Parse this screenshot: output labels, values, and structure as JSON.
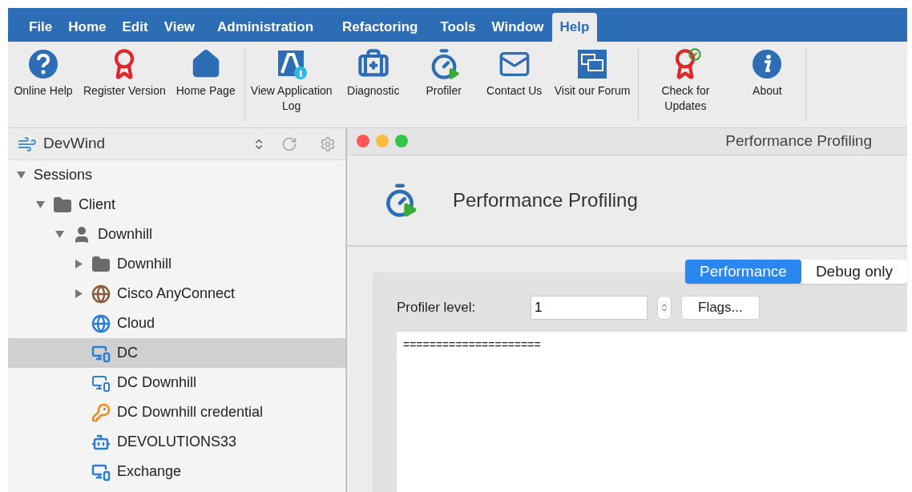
{
  "menu_bar": [
    {
      "label": "File",
      "selected": false
    },
    {
      "label": "Home",
      "selected": false
    },
    {
      "label": "Edit",
      "selected": false
    },
    {
      "label": "View",
      "selected": false
    },
    {
      "label": "Administration",
      "selected": false
    },
    {
      "label": "Refactoring",
      "selected": false
    },
    {
      "label": "Tools",
      "selected": false
    },
    {
      "label": "Window",
      "selected": false
    },
    {
      "label": "Help",
      "selected": true
    }
  ],
  "ribbon": {
    "groups": [
      {
        "items": [
          {
            "kind": "help",
            "label": "Online Help"
          },
          {
            "kind": "award",
            "label": "Register Version"
          },
          {
            "kind": "home",
            "label": "Home Page"
          }
        ]
      },
      {
        "items": [
          {
            "kind": "log",
            "label": "View Application Log"
          },
          {
            "kind": "medkit",
            "label": "Diagnostic"
          },
          {
            "kind": "timer",
            "label": "Profiler"
          },
          {
            "kind": "mail",
            "label": "Contact Us"
          },
          {
            "kind": "chat",
            "label": "Visit our Forum"
          }
        ]
      },
      {
        "items": [
          {
            "kind": "award-check",
            "label": "Check for Updates"
          },
          {
            "kind": "info",
            "label": "About"
          }
        ]
      }
    ]
  },
  "sidebar": {
    "title": "DevWind",
    "tree": [
      {
        "label": "Sessions",
        "expanded": true,
        "selected": false,
        "children": [
          {
            "label": "Client",
            "kind": "folder",
            "expanded": true,
            "selected": false,
            "children": [
              {
                "label": "Downhill",
                "kind": "user",
                "expanded": true,
                "selected": false,
                "children": [
                  {
                    "label": "Downhill",
                    "kind": "folder",
                    "expanded": false,
                    "selected": false
                  },
                  {
                    "label": "Cisco AnyConnect",
                    "kind": "vpn",
                    "expanded": false,
                    "selected": false
                  },
                  {
                    "label": "Cloud",
                    "kind": "web",
                    "selected": false
                  },
                  {
                    "label": "DC",
                    "kind": "rdp-star",
                    "selected": true
                  },
                  {
                    "label": "DC Downhill",
                    "kind": "rdp",
                    "selected": false
                  },
                  {
                    "label": "DC Downhill credential",
                    "kind": "key",
                    "selected": false
                  },
                  {
                    "label": "DEVOLUTIONS33",
                    "kind": "app",
                    "selected": false
                  },
                  {
                    "label": "Exchange",
                    "kind": "rdp-star",
                    "selected": false
                  }
                ]
              }
            ]
          }
        ]
      }
    ]
  },
  "window": {
    "title": "Performance Profiling",
    "heading": "Performance Profiling",
    "segments": [
      {
        "label": "Performance",
        "selected": true
      },
      {
        "label": "Debug only",
        "selected": false
      }
    ],
    "profiler_level": {
      "label": "Profiler level:",
      "value": "1"
    },
    "flags_button": "Flags...",
    "output": "====================="
  }
}
